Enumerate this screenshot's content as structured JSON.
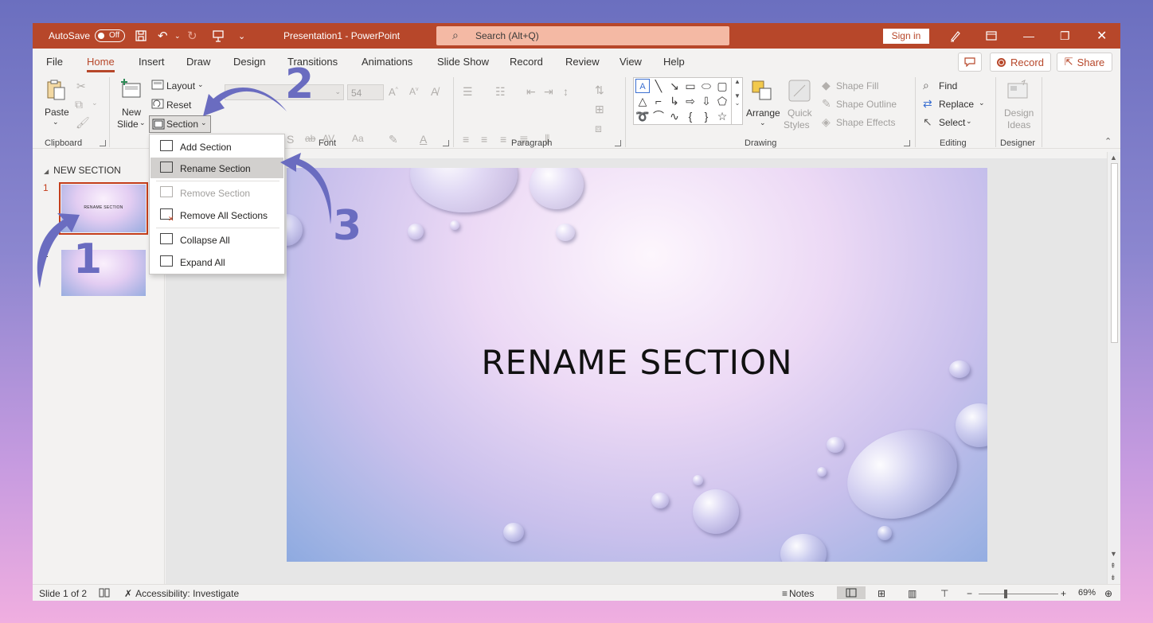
{
  "titlebar": {
    "autosave_label": "AutoSave",
    "autosave_state": "Off",
    "document_title": "Presentation1  -  PowerPoint",
    "search_placeholder": "Search (Alt+Q)",
    "signin_label": "Sign in"
  },
  "tabs": [
    {
      "label": "File"
    },
    {
      "label": "Home"
    },
    {
      "label": "Insert"
    },
    {
      "label": "Draw"
    },
    {
      "label": "Design"
    },
    {
      "label": "Transitions"
    },
    {
      "label": "Animations"
    },
    {
      "label": "Slide Show"
    },
    {
      "label": "Record"
    },
    {
      "label": "Review"
    },
    {
      "label": "View"
    },
    {
      "label": "Help"
    }
  ],
  "tab_actions": {
    "record": "Record",
    "share": "Share"
  },
  "ribbon": {
    "clipboard": {
      "paste": "Paste",
      "label": "Clipboard"
    },
    "slides": {
      "new_slide_1": "New",
      "new_slide_2": "Slide",
      "layout": "Layout",
      "reset": "Reset",
      "section": "Section"
    },
    "font": {
      "size": "54",
      "label": "Font"
    },
    "paragraph": {
      "label": "Paragraph"
    },
    "drawing": {
      "arrange": "Arrange",
      "quick_styles_1": "Quick",
      "quick_styles_2": "Styles",
      "shape_fill": "Shape Fill",
      "shape_outline": "Shape Outline",
      "shape_effects": "Shape Effects",
      "label": "Drawing"
    },
    "editing": {
      "find": "Find",
      "replace": "Replace",
      "select": "Select",
      "label": "Editing"
    },
    "designer": {
      "design_ideas_1": "Design",
      "design_ideas_2": "Ideas",
      "label": "Designer"
    }
  },
  "section_menu": {
    "items": [
      {
        "label": "Add Section"
      },
      {
        "label": "Rename Section"
      },
      {
        "label": "Remove Section"
      },
      {
        "label": "Remove All Sections"
      },
      {
        "label": "Collapse All"
      },
      {
        "label": "Expand All"
      }
    ]
  },
  "slides_pane": {
    "section_name": "NEW SECTION",
    "thumb_title": "RENAME SECTION",
    "slide_numbers": [
      "1",
      "2"
    ]
  },
  "slide": {
    "title": "RENAME SECTION"
  },
  "statusbar": {
    "slide_info": "Slide 1 of 2",
    "accessibility": "Accessibility: Investigate",
    "notes": "Notes",
    "zoom": "69%"
  },
  "annotations": [
    "1",
    "2",
    "3"
  ],
  "colors": {
    "accent": "#b7472a",
    "arrow": "#6a6cc0"
  }
}
